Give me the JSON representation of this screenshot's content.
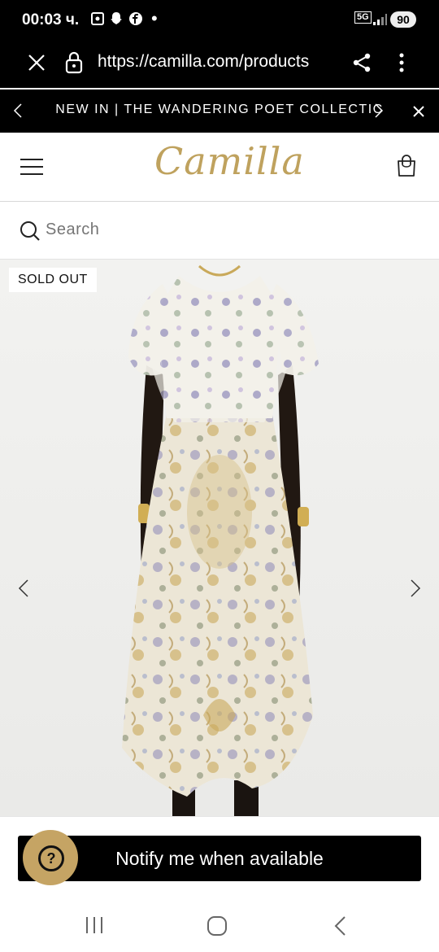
{
  "status_bar": {
    "time": "00:03 ч.",
    "network": "5G",
    "battery": "90"
  },
  "browser": {
    "url": "https://camilla.com/products"
  },
  "announcement": {
    "text": "NEW IN | THE WANDERING POET COLLECTIC"
  },
  "header": {
    "logo_text": "Camilla"
  },
  "search": {
    "placeholder": "Search"
  },
  "product": {
    "badge": "SOLD OUT"
  },
  "cta": {
    "notify_label": "Notify me when available"
  },
  "colors": {
    "brand_gold": "#bfa25e",
    "help_button": "#c5a464",
    "dark": "#000000"
  }
}
